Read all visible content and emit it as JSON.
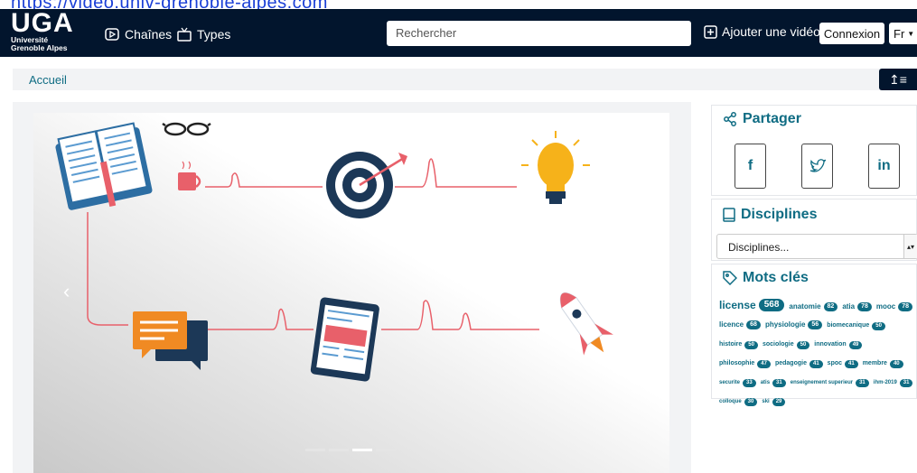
{
  "browser": {
    "url_text": "https://video.univ-grenoble-alpes.com"
  },
  "nav": {
    "logo_big": "UGA",
    "logo_line1": "Université",
    "logo_line2": "Grenoble Alpes",
    "channels_label": "Chaînes",
    "types_label": "Types",
    "search_placeholder": "Rechercher",
    "add_video_label": "Ajouter une vidéo",
    "login_label": "Connexion",
    "lang_label": "Fr"
  },
  "breadcrumb": {
    "home_label": "Accueil"
  },
  "sort_icon_label": "↥≡",
  "carousel": {
    "slide_count": 4,
    "active_index": 2
  },
  "share": {
    "title": "Partager",
    "buttons": [
      "facebook-icon",
      "twitter-icon",
      "linkedin-icon"
    ]
  },
  "disciplines": {
    "title": "Disciplines",
    "select_value": "Disciplines..."
  },
  "keywords": {
    "title": "Mots clés",
    "tags": [
      {
        "label": "license",
        "count": "568",
        "size": 12
      },
      {
        "label": "anatomie",
        "count": "82",
        "size": 8
      },
      {
        "label": "atia",
        "count": "78",
        "size": 8
      },
      {
        "label": "mooc",
        "count": "78",
        "size": 8
      },
      {
        "label": "licence",
        "count": "68",
        "size": 8
      },
      {
        "label": "physiologie",
        "count": "56",
        "size": 8
      },
      {
        "label": "biomecanique",
        "count": "50",
        "size": 7
      },
      {
        "label": "histoire",
        "count": "50",
        "size": 7
      },
      {
        "label": "sociologie",
        "count": "50",
        "size": 7
      },
      {
        "label": "innovation",
        "count": "49",
        "size": 7
      },
      {
        "label": "philosophie",
        "count": "47",
        "size": 7
      },
      {
        "label": "pedagogie",
        "count": "41",
        "size": 7
      },
      {
        "label": "spoc",
        "count": "41",
        "size": 7
      },
      {
        "label": "membre",
        "count": "40",
        "size": 7
      },
      {
        "label": "securite",
        "count": "33",
        "size": 6
      },
      {
        "label": "atis",
        "count": "31",
        "size": 6
      },
      {
        "label": "enseignement superieur",
        "count": "31",
        "size": 6
      },
      {
        "label": "ihm-2019",
        "count": "31",
        "size": 6
      },
      {
        "label": "colloque",
        "count": "30",
        "size": 6
      },
      {
        "label": "ski",
        "count": "29",
        "size": 6
      }
    ]
  },
  "colors": {
    "nav_bg": "#02152d",
    "accent": "#0f6c83",
    "logo_red": "#e63323"
  }
}
